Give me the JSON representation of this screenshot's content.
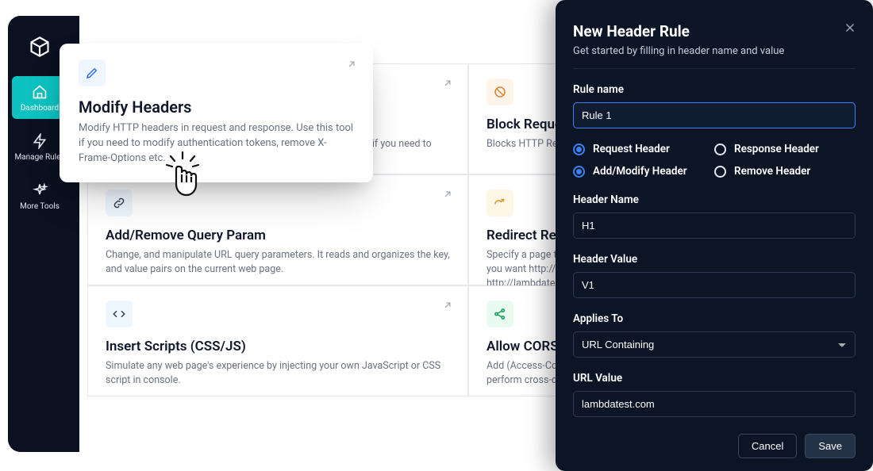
{
  "sidebar": {
    "items": [
      {
        "label": "Dashboard",
        "icon": "home",
        "active": true
      },
      {
        "label": "Manage Rules",
        "icon": "bolt",
        "active": false
      },
      {
        "label": "More Tools",
        "icon": "sparkle",
        "active": false
      }
    ]
  },
  "tooltip": {
    "title": "Modify Headers",
    "desc": "Modify HTTP headers in request and response. Use this tool if you need to modify authentication tokens, remove X-Frame-Options etc."
  },
  "cards": [
    {
      "icon": "pencil",
      "title": "Modify Headers",
      "desc": "Modify HTTP headers in request and response. Use this tool if you need to modify authentication tokens, remove X-Frame-Options etc."
    },
    {
      "icon": "block",
      "title": "Block Requests",
      "desc": "Blocks HTTP Requests based on your specified URL strings and conditions."
    },
    {
      "icon": "link",
      "title": "Add/Remove Query Param",
      "desc": "Change, and manipulate URL query parameters. It reads and organizes the key, and value pairs on the current web page."
    },
    {
      "icon": "redirect",
      "title": "Redirect Requests",
      "desc": "Specify a page that should be automatically redirected to another page. E.g. you want http://lambdatest.com/111 to redirect to http://lambdatest.com/222."
    },
    {
      "icon": "code",
      "title": "Insert Scripts (CSS/JS)",
      "desc": "Simulate any web page's experience by injecting your own JavaScript or CSS script in console."
    },
    {
      "icon": "share",
      "title": "Allow CORS",
      "desc": "Add (Access-Control-Allow-Origin: *) rule to the response header and easily perform cross-domain Ajax requests in web applications."
    }
  ],
  "modal": {
    "title": "New Header Rule",
    "subtitle": "Get started by filling in header name and value",
    "rule_name_label": "Rule name",
    "rule_name_value": "Rule 1",
    "radios": {
      "request_header": "Request Header",
      "response_header": "Response Header",
      "add_modify": "Add/Modify Header",
      "remove_header": "Remove Header"
    },
    "header_name_label": "Header Name",
    "header_name_value": "H1",
    "header_value_label": "Header Value",
    "header_value_value": "V1",
    "applies_to_label": "Applies To",
    "applies_to_value": "URL Containing",
    "url_value_label": "URL Value",
    "url_value_value": "lambdatest.com",
    "cancel": "Cancel",
    "save": "Save"
  },
  "colors": {
    "accent": "#0dc2c1",
    "dark": "#0b1120",
    "modal_bg": "#0b1526",
    "primary_blue": "#3b82f6"
  }
}
